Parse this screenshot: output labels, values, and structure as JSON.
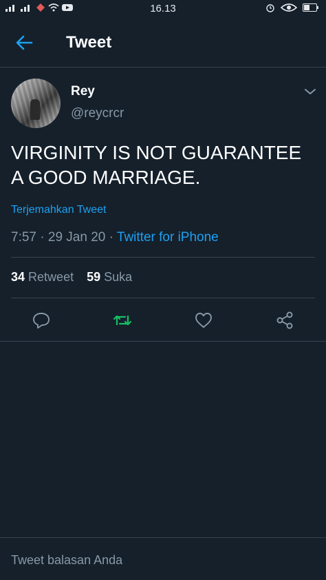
{
  "status_bar": {
    "time": "16.13"
  },
  "header": {
    "title": "Tweet"
  },
  "tweet": {
    "display_name": "Rey",
    "handle": "@reycrcr",
    "text": "VIRGINITY IS NOT GUARANTEE A GOOD MARRIAGE.",
    "translate_label": "Terjemahkan Tweet",
    "time": "7:57",
    "date": "29 Jan 20",
    "separator": "·",
    "source": "Twitter for iPhone",
    "retweet_count": "34",
    "retweet_label": "Retweet",
    "like_count": "59",
    "like_label": "Suka"
  },
  "reply": {
    "placeholder": "Tweet balasan Anda"
  },
  "colors": {
    "background": "#15202b",
    "accent": "#1da1f2",
    "muted": "#8899a6",
    "retweet_active": "#17bf63",
    "divider": "#38444d"
  },
  "icons": {
    "back": "arrow-left-icon",
    "more": "chevron-down-icon",
    "reply": "reply-bubble-icon",
    "retweet": "retweet-icon",
    "like": "heart-icon",
    "share": "share-icon"
  }
}
